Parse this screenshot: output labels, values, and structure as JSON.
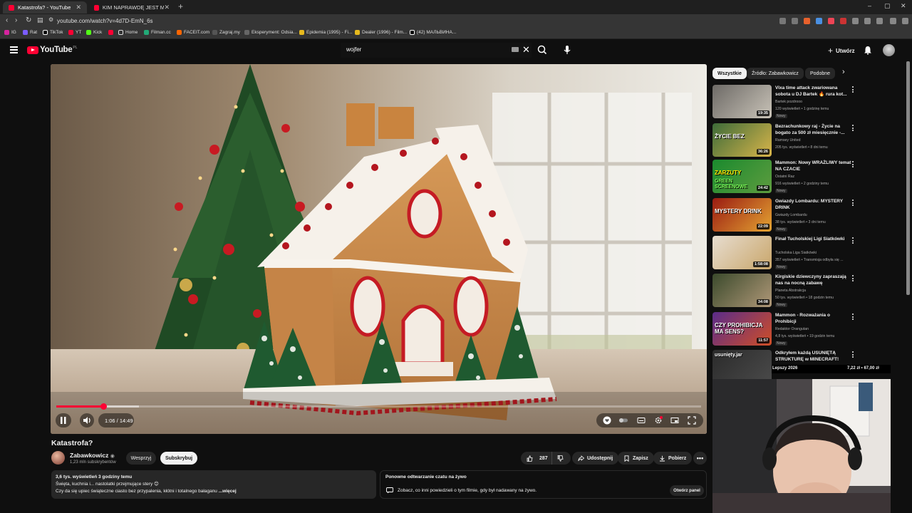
{
  "browser": {
    "tabs": [
      {
        "title": "Katastrofa? - YouTube"
      },
      {
        "title": "KIM NAPRAWDĘ JEST MAKALIER? W"
      }
    ],
    "url": "youtube.com/watch?v=4d7D-EmN_6s",
    "bookmarks": [
      "IG",
      "Rat",
      "TikTok",
      "YT",
      "Kick",
      "Home",
      "Filman.cc",
      "FACEIT.com",
      "Zagraj.my",
      "Eksperyment: Odsia...",
      "Epidemia (1995) - Fi...",
      "Dealer (1996) - Film...",
      "(42) МАЛЬВИНА..."
    ]
  },
  "header": {
    "logo": "YouTube",
    "country": "PL",
    "search_query": "wojfer",
    "create_label": "Utwórz"
  },
  "player": {
    "time": "1:06 / 14:49",
    "progress": 0.074,
    "buffered": 0.128
  },
  "video": {
    "title": "Katastrofa?",
    "channel": "Zabawkowicz",
    "subscribers": "1,23 mln subskrybentów",
    "support_label": "Wesprzyj",
    "subscribe_label": "Subskrybuj",
    "likes": "287",
    "share_label": "Udostępnij",
    "save_label": "Zapisz",
    "download_label": "Pobierz",
    "desc_meta": "3,6 tys. wyświetleń  3 godziny temu",
    "desc_line1": "Święta, kuchnia i... nastolatki przejmujące stery 😊",
    "desc_line2": "Czy da się upiec świąteczne ciasto bez przypalenia, kłótni i totalnego bałaganu",
    "desc_more": "...więcej",
    "live_title": "Ponowne odtwarzanie czatu na żywo",
    "live_text": "Zobacz, co inni powiedzieli o tym filmie, gdy był nadawany na żywo.",
    "live_btn": "Otwórz panel"
  },
  "chips": [
    "Wszystkie",
    "Źródło: Zabawkowicz",
    "Podobne"
  ],
  "recommendations": [
    {
      "title": "Vixa time attack zwariowana sobota u DJ Bartek 🔥 rura kot...",
      "channel": "Bartek pozdrooo",
      "meta": "120 wyświetleń • 1 godzinę temu",
      "badge": "Nowy",
      "duration": "19:35",
      "colors": [
        "#6d6a66",
        "#c9c3b8"
      ]
    },
    {
      "title": "Bezrachunkowy raj - Życie na bogato za 500 zł miesięcznie -...",
      "channel": "Ramsey United",
      "meta": "205 tys. wyświetleń • 8 dni temu",
      "badge": "",
      "duration": "36:26",
      "colors": [
        "#3d6b39",
        "#d9b54a"
      ]
    },
    {
      "title": "Mammon: Nowy WRAŻLIWY temat NA CZACIE",
      "channel": "Ostatni Raz",
      "meta": "916 wyświetleń • 2 godziny temu",
      "badge": "Nowy",
      "duration": "24:42",
      "colors": [
        "#1a8a2e",
        "#5e9c3f"
      ]
    },
    {
      "title": "Gwiazdy Lombardu: MYSTERY DRINK",
      "channel": "Gwiazdy Lombardu",
      "meta": "38 tys. wyświetleń • 3 dni temu",
      "badge": "Nowy",
      "duration": "22:09",
      "colors": [
        "#9a1b12",
        "#e4a432"
      ]
    },
    {
      "title": "Finał Tucholskiej Ligi Siatkówki",
      "channel": "Tucholska Liga Siatkówki",
      "meta": "357 wyświetleń • Transmisja odbyła się ...",
      "badge": "Nowy",
      "duration": "1:58:08",
      "colors": [
        "#e7ddd0",
        "#c9a66a"
      ]
    },
    {
      "title": "Kirgiskie dziewczyny zapraszają nas na nocną zabawę",
      "channel": "Planeta Abstrakcja",
      "meta": "50 tys. wyświetleń • 18 godzin temu",
      "badge": "Nowy",
      "duration": "34:08",
      "colors": [
        "#3b4a2c",
        "#b09878"
      ]
    },
    {
      "title": "Mammon - Rozważania o Prohibicji",
      "channel": "Redaktor Orangutan",
      "meta": "4,8 tys. wyświetleń • 19 godzin temu",
      "badge": "Nowy",
      "duration": "11:57",
      "colors": [
        "#5a2c8a",
        "#d04e26"
      ]
    },
    {
      "title": "Odkryłem każdą USUNIĘTĄ STRUKTURĘ w MINECRAFT!",
      "channel": "",
      "meta": "1,7 tys. wyświetleń • 4 tygodnie temu",
      "badge": "",
      "duration": "",
      "colors": [
        "#2b2b2b",
        "#4a4a4a"
      ]
    }
  ],
  "overlay": {
    "left": "Lepszy 2026",
    "right": "7,22 zł • 67,00 zł"
  },
  "thumb_texts": {
    "r2": "ŻYCIE BEZ",
    "r3a": "ZARZUTY",
    "r3b": "GREEN SCREENOWE",
    "r4": "MYSTERY DRINK",
    "r7": "CZY PROHIBICJA MA SENS?",
    "r8": "usunięty.jar"
  }
}
